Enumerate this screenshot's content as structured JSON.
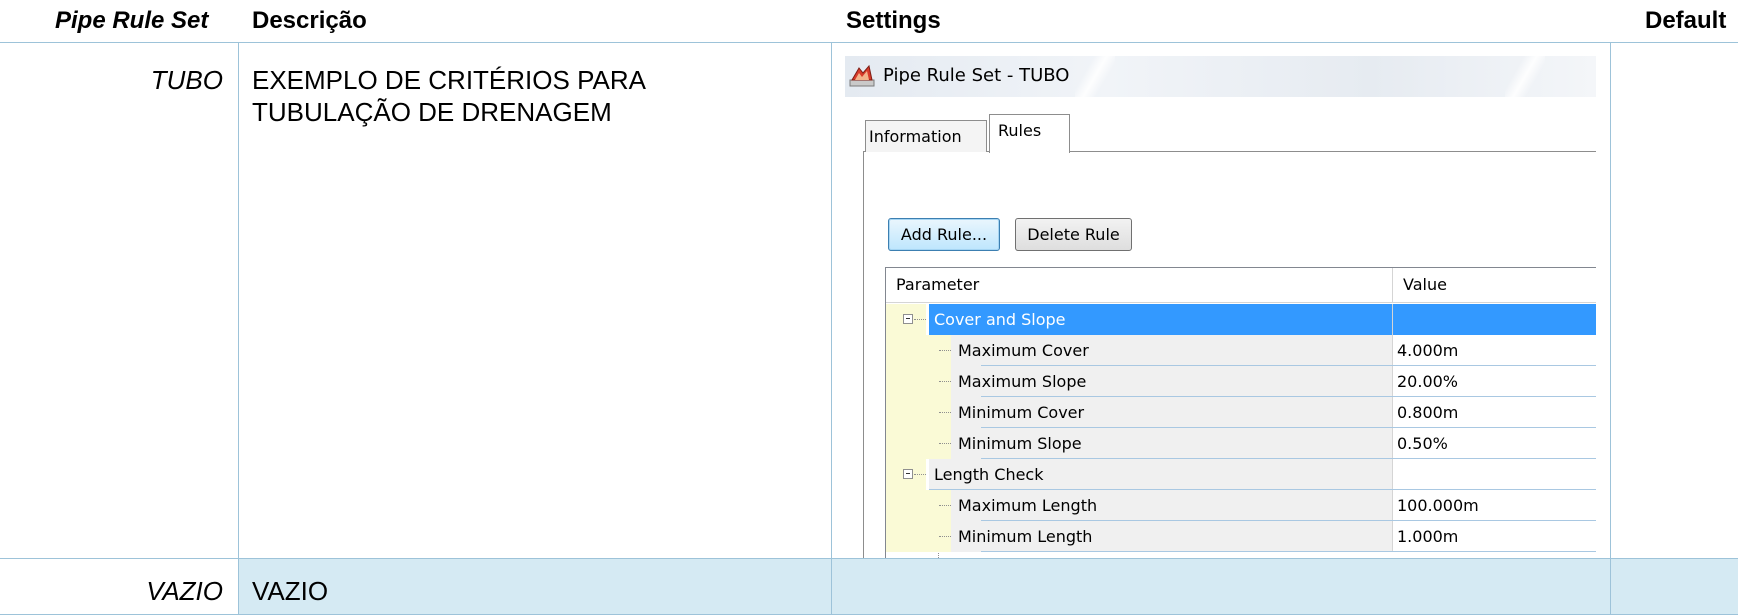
{
  "columns": {
    "pipe_rule_set": "Pipe Rule Set",
    "descricao": "Descrição",
    "settings": "Settings",
    "default": "Default"
  },
  "rows": [
    {
      "name": "TUBO",
      "description": "EXEMPLO DE CRITÉRIOS PARA TUBULAÇÃO DE DRENAGEM"
    },
    {
      "name": "VAZIO",
      "description": "VAZIO"
    }
  ],
  "dialog": {
    "title": "Pipe Rule Set - TUBO",
    "tabs": [
      "Information",
      "Rules"
    ],
    "active_tab": "Rules",
    "buttons": {
      "add": "Add Rule...",
      "delete": "Delete Rule"
    },
    "grid": {
      "headers": {
        "parameter": "Parameter",
        "value": "Value"
      },
      "groups": [
        {
          "label": "Cover and Slope",
          "selected": true,
          "items": [
            {
              "label": "Maximum Cover",
              "value": "4.000m"
            },
            {
              "label": "Maximum Slope",
              "value": "20.00%"
            },
            {
              "label": "Minimum Cover",
              "value": "0.800m"
            },
            {
              "label": "Minimum Slope",
              "value": "0.50%"
            }
          ]
        },
        {
          "label": "Length Check",
          "selected": false,
          "items": [
            {
              "label": "Maximum Length",
              "value": "100.000m"
            },
            {
              "label": "Minimum Length",
              "value": "1.000m"
            }
          ]
        }
      ]
    }
  },
  "colors": {
    "table_border": "#9dc3d9",
    "vazio_band": "#d5eaf3",
    "selection": "#3399ff",
    "tree_gutter": "#fafad6"
  },
  "icons": {
    "dialog_icon": "civil-pipe-app-icon"
  }
}
